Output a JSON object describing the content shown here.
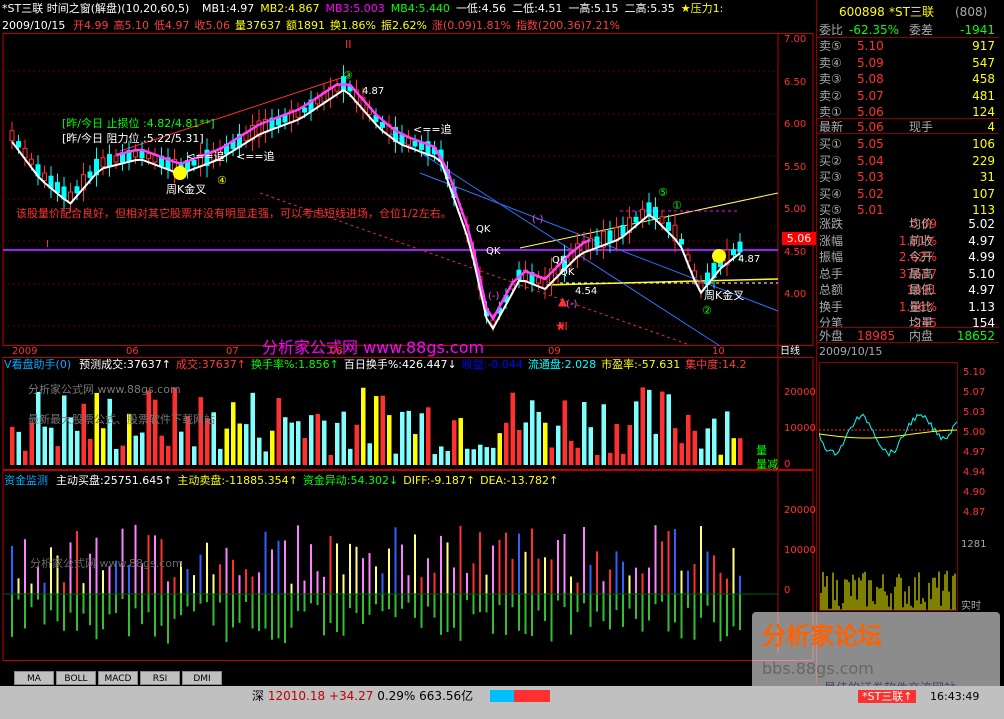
{
  "window": {
    "title": "*ST三联 时间之窗(解盘)(10,20,60,5)",
    "min": "_",
    "max": "□",
    "close": "×"
  },
  "header": {
    "ma_line": [
      {
        "text": "MB1:4.97",
        "color": "#ffffff"
      },
      {
        "text": "MB2:4.867",
        "color": "#ffff00"
      },
      {
        "text": "MB3:5.003",
        "color": "#ff00ff"
      },
      {
        "text": "MB4:5.440",
        "color": "#00ff00"
      },
      {
        "text": "一低:4.56",
        "color": "#ffffff"
      },
      {
        "text": "二低:4.51",
        "color": "#ffffff"
      },
      {
        "text": "一高:5.15",
        "color": "#ffffff"
      },
      {
        "text": "二高:5.35",
        "color": "#ffffff"
      },
      {
        "text": "★压力1:",
        "color": "#ffff00"
      }
    ],
    "date": "2009/10/15",
    "ohlc": [
      {
        "text": "开4.99",
        "color": "#ff3c3c"
      },
      {
        "text": "高5.10",
        "color": "#ff3c3c"
      },
      {
        "text": "低4.97",
        "color": "#ff3c3c"
      },
      {
        "text": "收5.06",
        "color": "#ff3c3c"
      },
      {
        "text": "量37637",
        "color": "#ffff00"
      },
      {
        "text": "额1891",
        "color": "#ffff00"
      },
      {
        "text": "换1.86%",
        "color": "#ffff00"
      },
      {
        "text": "振2.62%",
        "color": "#ffff00"
      },
      {
        "text": "涨(0.09)1.81%",
        "color": "#ff3c3c"
      },
      {
        "text": "指数(200.36)7.21%",
        "color": "#ff3c3c"
      }
    ]
  },
  "main_chart": {
    "price_axis": [
      "7.00",
      "6.50",
      "6.00",
      "5.50",
      "5.00",
      "4.50",
      "4.00"
    ],
    "current_price": "5.06",
    "stoploss_text": "[昨/今日 止损位 :4.82/4.81**]",
    "resistance_text": "[昨/今日 阻力位 :5.22/5.31]",
    "comment": "该股量价配合良好，但相对其它股票并没有明显走强，可以考虑短线进场，仓位1/2左右。",
    "site_banner": "分析家公式网 www.88gs.com",
    "labels": {
      "ii": "II",
      "iii": "III",
      "i": "I",
      "c3": "③",
      "c4": "④",
      "c5": "⑤",
      "c1": "①",
      "c2": "②",
      "minus1": "(-)",
      "minus2": "(-)",
      "minus3": "(-)",
      "zhui1": "<==追",
      "zhui2": "<==追",
      "zhui3": "<==追",
      "qk1": "QK",
      "qk2": "QK",
      "qk3": "QK",
      "qk4": "QK",
      "zhoukjc1": "周K金叉",
      "zhoukjc2": "周K金叉",
      "v487": "4.87",
      "v487b": "4.87",
      "v454": "4.54",
      "v5": "5"
    },
    "x_axis": [
      "2009",
      "06",
      "07",
      "08",
      "09",
      "10",
      "日线"
    ]
  },
  "vol_panel": {
    "indicator": "V看盘助手(0)",
    "items": [
      {
        "text": "预测成交:37637↑",
        "color": "#ffffff"
      },
      {
        "text": "成交:37637↑",
        "color": "#ff3c3c"
      },
      {
        "text": "换手率%:1.856↑",
        "color": "#00ff00"
      },
      {
        "text": "百日换手%:426.447↓",
        "color": "#ffffff"
      },
      {
        "text": "收益:-0.044",
        "color": "#0000ff"
      },
      {
        "text": "流通盘:2.028",
        "color": "#00ffff"
      },
      {
        "text": "市盈率:-57.631",
        "color": "#ffff00"
      },
      {
        "text": "集中度:14.2",
        "color": "#ff3c3c"
      }
    ],
    "axis": [
      "200000",
      "100000",
      "0"
    ],
    "watermark1": "分析家公式网 www.88gs.com",
    "watermark2": "最新最大股票公式、股票软件下载网站",
    "side_label": "量减",
    "side_label2": "量"
  },
  "fund_panel": {
    "indicator": "资金监测",
    "items": [
      {
        "text": "主动买盘:25751.645↑",
        "color": "#ffffff"
      },
      {
        "text": "主动卖盘:-11885.354↑",
        "color": "#ffff00"
      },
      {
        "text": "资金异动:54.302↓",
        "color": "#00ff00"
      },
      {
        "text": "DIFF:-9.187↑",
        "color": "#ffff00"
      },
      {
        "text": "DEA:-13.782↑",
        "color": "#ffff00"
      }
    ],
    "axis": [
      "200000",
      "100000",
      "0"
    ],
    "watermark": "分析家公式网 www.88gs.com"
  },
  "bottom_tabs": [
    "MA",
    "BOLL",
    "MACD",
    "RSI",
    "DMI"
  ],
  "quote": {
    "code": "600898",
    "name": "*ST三联",
    "code_suffix": "(808)",
    "weibi_label": "委比",
    "weibi": "-62.35%",
    "weicha_label": "委差",
    "weicha": "-1941",
    "sell": [
      {
        "l": "卖⑤",
        "p": "5.10",
        "v": "917"
      },
      {
        "l": "卖④",
        "p": "5.09",
        "v": "547"
      },
      {
        "l": "卖③",
        "p": "5.08",
        "v": "458"
      },
      {
        "l": "卖②",
        "p": "5.07",
        "v": "481"
      },
      {
        "l": "卖①",
        "p": "5.06",
        "v": "124"
      }
    ],
    "latest_label": "最新",
    "latest": "5.06",
    "xianshou_label": "现手",
    "xianshou": "4",
    "buy": [
      {
        "l": "买①",
        "p": "5.05",
        "v": "106"
      },
      {
        "l": "买②",
        "p": "5.04",
        "v": "229"
      },
      {
        "l": "买③",
        "p": "5.03",
        "v": "31"
      },
      {
        "l": "买④",
        "p": "5.02",
        "v": "107"
      },
      {
        "l": "买⑤",
        "p": "5.01",
        "v": "113"
      }
    ],
    "stats": [
      {
        "l1": "涨跌",
        "v1": "0.09",
        "l2": "均价",
        "v2": "5.02"
      },
      {
        "l1": "涨幅",
        "v1": "1.81%",
        "l2": "前收",
        "v2": "4.97"
      },
      {
        "l1": "振幅",
        "v1": "2.62%",
        "l2": "今开",
        "v2": "4.99"
      },
      {
        "l1": "总手",
        "v1": "37637",
        "l2": "最高",
        "v2": "5.10"
      },
      {
        "l1": "总额",
        "v1": "1891",
        "l2": "最低",
        "v2": "4.97"
      },
      {
        "l1": "换手",
        "v1": "1.86%",
        "l2": "量比",
        "v2": "1.13"
      },
      {
        "l1": "分笔",
        "v1": "245",
        "l2": "均量",
        "v2": "154"
      }
    ],
    "waipan_label": "外盘",
    "waipan": "18985",
    "neipan_label": "内盘",
    "neipan": "18652",
    "mini_date": "2009/10/15",
    "mini_axis": [
      "5.10",
      "5.07",
      "5.03",
      "5.00",
      "4.97",
      "4.94",
      "4.90",
      "4.87"
    ],
    "mini_vol": "1281",
    "realtime": "实时"
  },
  "status": {
    "index_name": "深",
    "index": "12010.18",
    "change": "+34.27",
    "pct": "0.29%",
    "amount": "663.56亿",
    "stock_tab": "*ST三联↑",
    "time": "16:43:49"
  },
  "forum": {
    "title": "分析家论坛",
    "url": "bbs.88gs.com",
    "sub": "最佳的证券软件交流网站"
  }
}
